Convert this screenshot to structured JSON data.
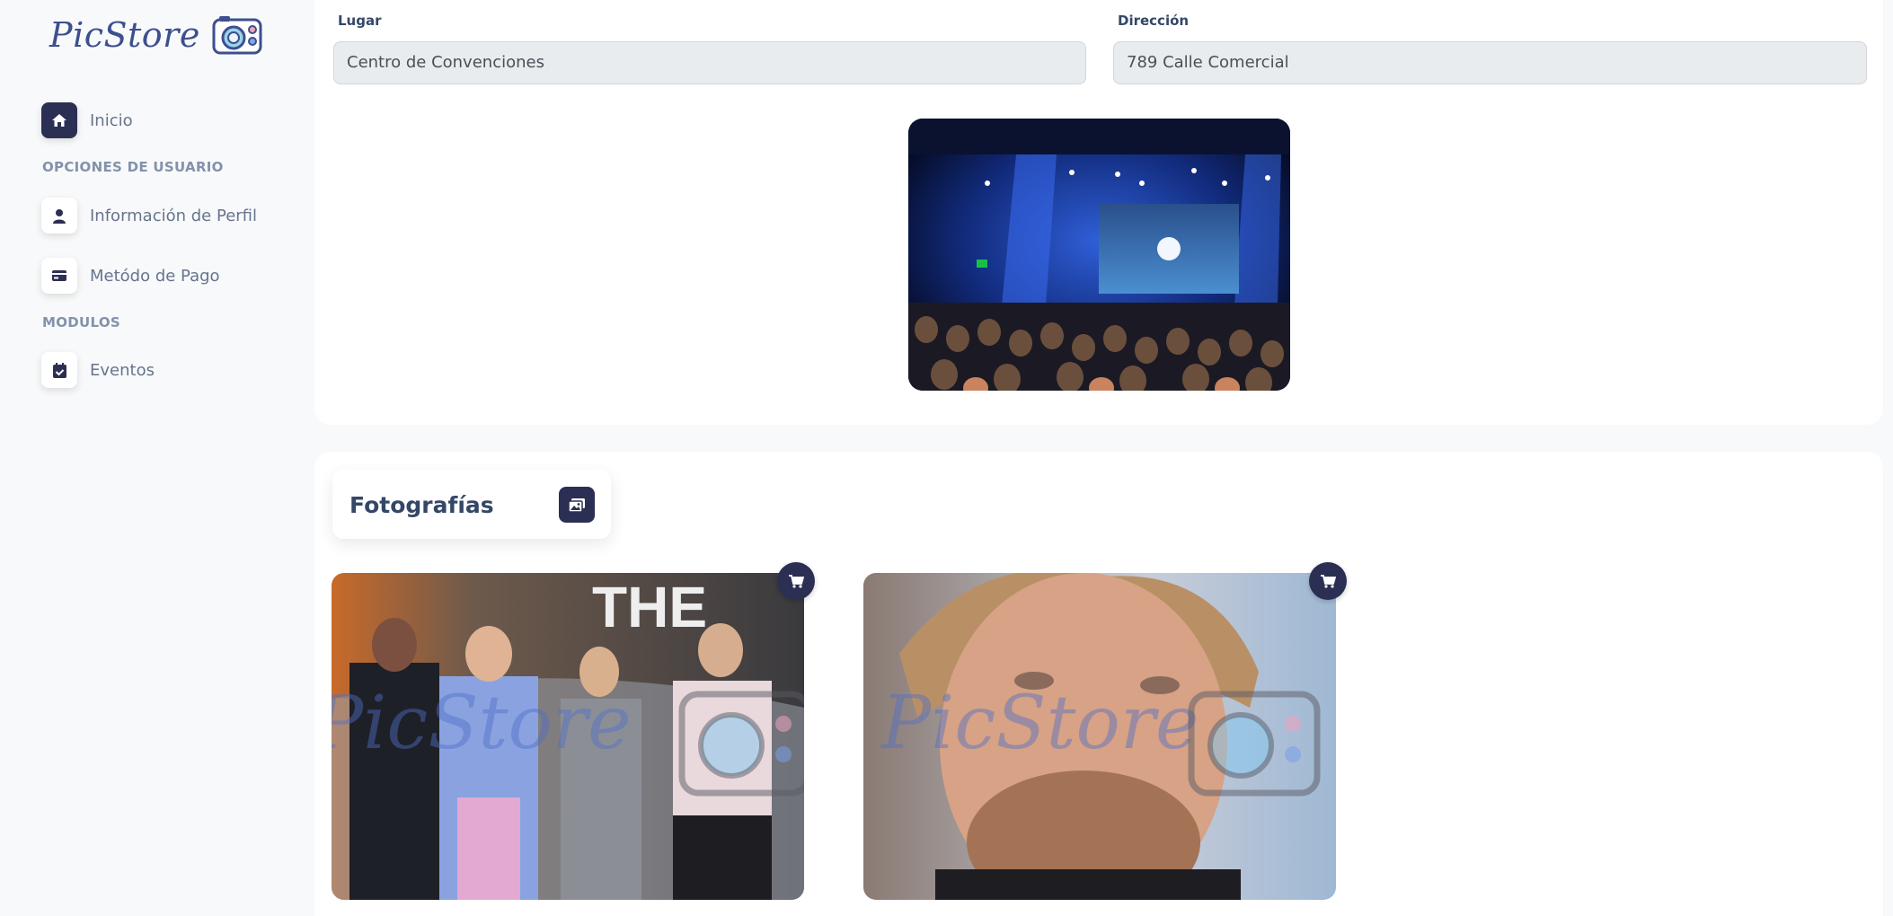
{
  "brand": {
    "name": "PicStore"
  },
  "sidebar": {
    "items": [
      {
        "label": "Inicio",
        "icon": "home-icon",
        "active": true
      },
      {
        "label": "Información de Perfil",
        "icon": "user-icon"
      },
      {
        "label": "Metódo de Pago",
        "icon": "credit-card-icon"
      },
      {
        "label": "Eventos",
        "icon": "calendar-check-icon"
      }
    ],
    "sections": [
      "OPCIONES DE USUARIO",
      "MODULOS"
    ]
  },
  "event": {
    "lugar_label": "Lugar",
    "lugar_value": "Centro de Convenciones",
    "direccion_label": "Dirección",
    "direccion_value": "789 Calle Comercial"
  },
  "photos": {
    "title": "Fotografías",
    "items": [
      {
        "watermark": "PicStore",
        "icon": "cart-icon"
      },
      {
        "watermark": "PicStore",
        "icon": "cart-icon"
      }
    ]
  },
  "colors": {
    "primary": "#2c2f54",
    "brand": "#3d4f8f",
    "background": "#f8f9fa"
  }
}
